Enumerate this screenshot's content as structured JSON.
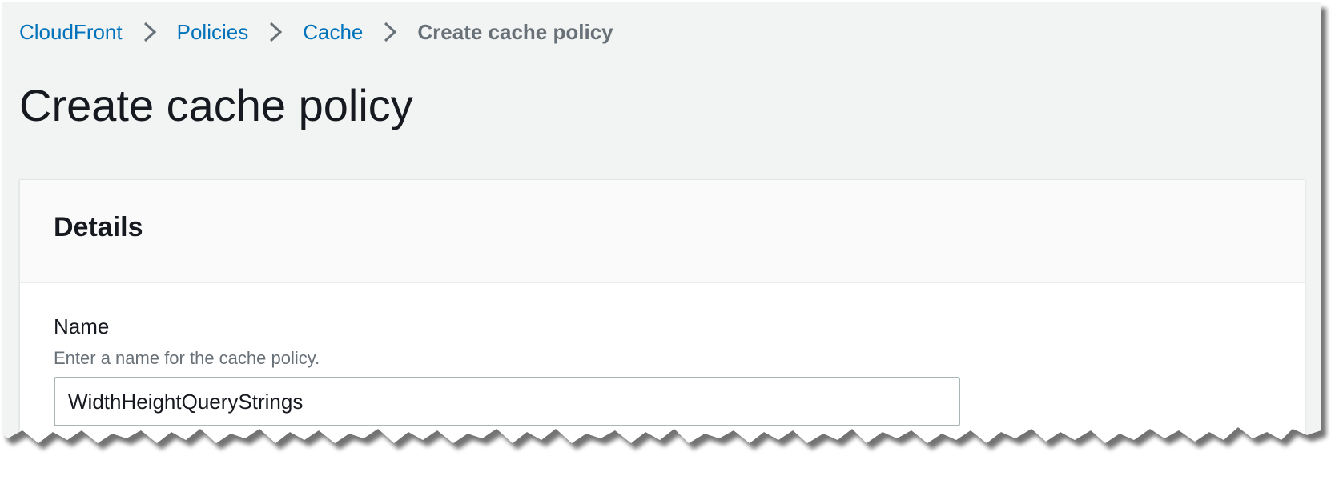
{
  "breadcrumb": {
    "items": [
      "CloudFront",
      "Policies",
      "Cache"
    ],
    "current": "Create cache policy"
  },
  "page_title": "Create cache policy",
  "details": {
    "title": "Details",
    "name_label": "Name",
    "name_description": "Enter a name for the cache policy.",
    "name_value": "WidthHeightQueryStrings"
  },
  "icons": {
    "breadcrumb_separator": "chevron-right-icon"
  },
  "colors": {
    "link": "#0073bb",
    "current_crumb": "#687078",
    "text": "#16191f",
    "page_background": "#f2f3f3"
  }
}
